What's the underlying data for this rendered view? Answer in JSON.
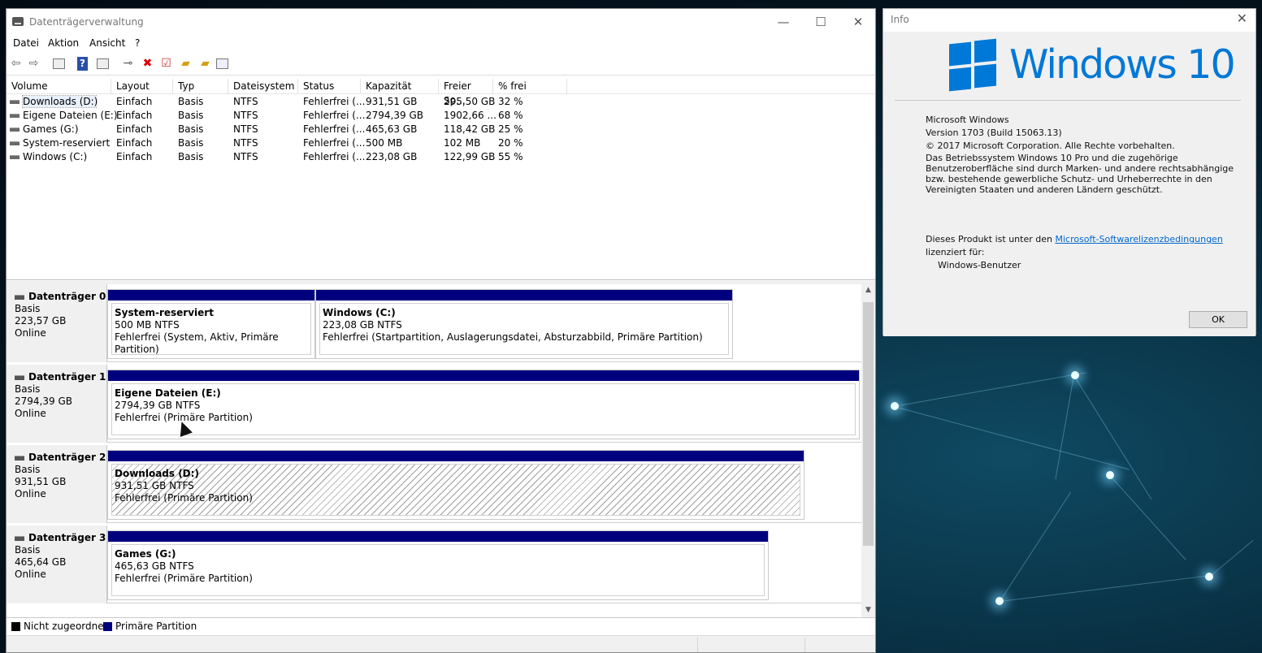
{
  "main_window": {
    "title": "Datenträgerverwaltung",
    "controls": {
      "minimize": "—",
      "maximize": "☐",
      "close": "✕"
    },
    "menu": [
      "Datei",
      "Aktion",
      "Ansicht",
      "?"
    ],
    "toolbar_icons": [
      "back-icon",
      "forward-icon",
      "console-tree-icon",
      "help-icon",
      "properties-icon",
      "connect-icon",
      "delete-icon",
      "check-icon",
      "folder-up-icon",
      "search-folder-icon",
      "settings-icon"
    ]
  },
  "volume_list": {
    "columns": [
      "Volume",
      "Layout",
      "Typ",
      "Dateisystem",
      "Status",
      "Kapazität",
      "Freier Sp...",
      "% frei"
    ],
    "rows": [
      [
        "Downloads (D:)",
        "Einfach",
        "Basis",
        "NTFS",
        "Fehlerfrei (...",
        "931,51 GB",
        "295,50 GB",
        "32 %"
      ],
      [
        "Eigene Dateien (E:)",
        "Einfach",
        "Basis",
        "NTFS",
        "Fehlerfrei (...",
        "2794,39 GB",
        "1902,66 ...",
        "68 %"
      ],
      [
        "Games (G:)",
        "Einfach",
        "Basis",
        "NTFS",
        "Fehlerfrei (...",
        "465,63 GB",
        "118,42 GB",
        "25 %"
      ],
      [
        "System-reserviert",
        "Einfach",
        "Basis",
        "NTFS",
        "Fehlerfrei (...",
        "500 MB",
        "102 MB",
        "20 %"
      ],
      [
        "Windows (C:)",
        "Einfach",
        "Basis",
        "NTFS",
        "Fehlerfrei (...",
        "223,08 GB",
        "122,99 GB",
        "55 %"
      ]
    ]
  },
  "disks": [
    {
      "name": "Datenträger 0",
      "type": "Basis",
      "size": "223,57 GB",
      "state": "Online",
      "partitions": [
        {
          "name": "System-reserviert",
          "size": "500 MB NTFS",
          "status": "Fehlerfrei (System, Aktiv, Primäre Partition)"
        },
        {
          "name": "Windows  (C:)",
          "size": "223,08 GB NTFS",
          "status": "Fehlerfrei (Startpartition, Auslagerungsdatei, Absturzabbild, Primäre Partition)"
        }
      ]
    },
    {
      "name": "Datenträger 1",
      "type": "Basis",
      "size": "2794,39 GB",
      "state": "Online",
      "partitions": [
        {
          "name": "Eigene Dateien  (E:)",
          "size": "2794,39 GB NTFS",
          "status": "Fehlerfrei (Primäre Partition)"
        }
      ]
    },
    {
      "name": "Datenträger 2",
      "type": "Basis",
      "size": "931,51 GB",
      "state": "Online",
      "partitions": [
        {
          "name": "Downloads  (D:)",
          "size": "931,51 GB NTFS",
          "status": "Fehlerfrei (Primäre Partition)"
        }
      ]
    },
    {
      "name": "Datenträger 3",
      "type": "Basis",
      "size": "465,64 GB",
      "state": "Online",
      "partitions": [
        {
          "name": "Games  (G:)",
          "size": "465,63 GB NTFS",
          "status": "Fehlerfrei (Primäre Partition)"
        }
      ]
    }
  ],
  "legend": {
    "unallocated": "Nicht zugeordnet",
    "primary": "Primäre Partition",
    "unallocated_color": "#000000",
    "primary_color": "#00007f"
  },
  "info_dialog": {
    "title": "Info",
    "close": "✕",
    "logo_text": "Windows 10",
    "brand_color": "#0078d7",
    "product": "Microsoft Windows",
    "version": "Version 1703 (Build 15063.13)",
    "copyright": "© 2017 Microsoft Corporation. Alle Rechte vorbehalten.",
    "legal": "Das Betriebssystem Windows 10 Pro und die zugehörige Benutzeroberfläche sind durch Marken- und andere rechtsabhängige bzw. bestehende gewerbliche Schutz- und Urheberrechte in den Vereinigten Staaten und anderen Ländern geschützt.",
    "license_pre": "Dieses Produkt ist unter den ",
    "license_link": "Microsoft-Softwarelizenzbedingungen",
    "license_post": " lizenziert für:",
    "user": "Windows-Benutzer",
    "ok": "OK"
  }
}
